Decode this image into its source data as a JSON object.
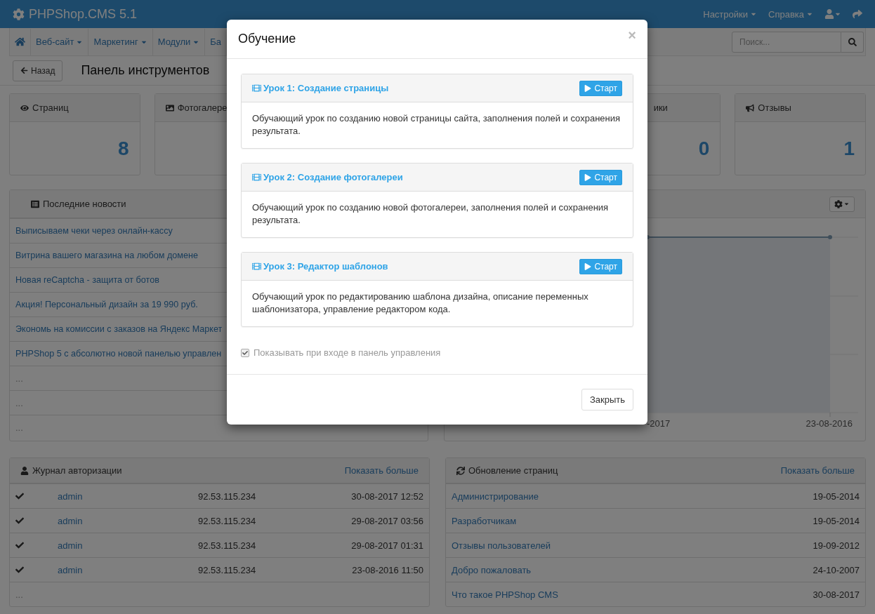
{
  "navbar": {
    "brand": "PHPShop.CMS 5.1",
    "menus": [
      {
        "label": "Настройки"
      },
      {
        "label": "Справка"
      }
    ]
  },
  "menu_bar": {
    "items": [
      {
        "label": "Веб-сайт",
        "dropdown": true
      },
      {
        "label": "Маркетинг",
        "dropdown": true
      },
      {
        "label": "Модули",
        "dropdown": true
      },
      {
        "label": "Ба",
        "dropdown": false
      }
    ],
    "search": {
      "placeholder": "Поиск..."
    }
  },
  "toolbar": {
    "back_button": "Назад",
    "title": "Панель инструментов"
  },
  "stats": [
    {
      "kind": "full",
      "title": "Страниц",
      "value": "8"
    },
    {
      "kind": "full",
      "title": "Фотогалере"
    },
    {
      "kind": "cut",
      "title": "ики",
      "value": "0"
    },
    {
      "kind": "full",
      "title": "Отзывы",
      "value": "1"
    }
  ],
  "news": {
    "title": "Последние новости",
    "items": [
      {
        "kind": "link",
        "text": "Выписываем чеки через онлайн-кассу"
      },
      {
        "kind": "link",
        "text": "Витрина вашего магазина на любом домене"
      },
      {
        "kind": "link",
        "text": "Новая reCaptcha - защита от ботов"
      },
      {
        "kind": "link",
        "text": "Акция! Персональный дизайн за 19 990 руб."
      },
      {
        "kind": "link",
        "text": "Экономь на комиссии с заказов на Яндекс Маркет"
      },
      {
        "kind": "link",
        "text": "PHPShop 5 с абсолютно новой панелью управлен"
      },
      {
        "kind": "empty",
        "text": "..."
      },
      {
        "kind": "empty",
        "text": "..."
      },
      {
        "kind": "empty",
        "text": "..."
      }
    ]
  },
  "chart_panel": {
    "x_labels": [
      "-2017",
      "23-08-2016"
    ]
  },
  "auth_log": {
    "title": "Журнал авторизации",
    "more": "Показать больше",
    "rows": [
      {
        "user": "admin",
        "ip": "92.53.115.234",
        "time": "30-08-2017 12:52"
      },
      {
        "user": "admin",
        "ip": "92.53.115.234",
        "time": "29-08-2017 03:56"
      },
      {
        "user": "admin",
        "ip": "92.53.115.234",
        "time": "29-08-2017 01:31"
      },
      {
        "user": "admin",
        "ip": "92.53.115.234",
        "time": "23-08-2016 11:50"
      }
    ],
    "footer": "..."
  },
  "updates": {
    "title": "Обновление страниц",
    "more": "Показать больше",
    "rows": [
      {
        "page": "Администрирование",
        "date": "19-05-2014"
      },
      {
        "page": "Разработчикам",
        "date": "19-05-2014"
      },
      {
        "page": "Отзывы пользователей",
        "date": "19-09-2012"
      },
      {
        "page": "Добро пожаловать",
        "date": "24-10-2007"
      },
      {
        "page": "Что такое PHPShop CMS",
        "date": "30-08-2017"
      }
    ]
  },
  "modal": {
    "title": "Обучение",
    "close": "×",
    "lessons": [
      {
        "title": "Урок 1: Создание страницы",
        "button": "Старт",
        "text": "Обучающий урок по созданию новой страницы сайта, заполнения полей и сохранения результата."
      },
      {
        "title": "Урок 2: Создание фотогалереи",
        "button": "Старт",
        "text": "Обучающий урок по созданию новой фотогалереи, заполнения полей и сохранения результата."
      },
      {
        "title": "Урок 3: Редактор шаблонов",
        "button": "Старт",
        "text": "Обучающий урок по редактированию шаблона дизайна, описание переменных шаблонизатора, управление редактором кода."
      }
    ],
    "checkbox": {
      "label": "Показывать при входе в панель управления",
      "checked": true
    },
    "close_button": "Закрыть"
  }
}
